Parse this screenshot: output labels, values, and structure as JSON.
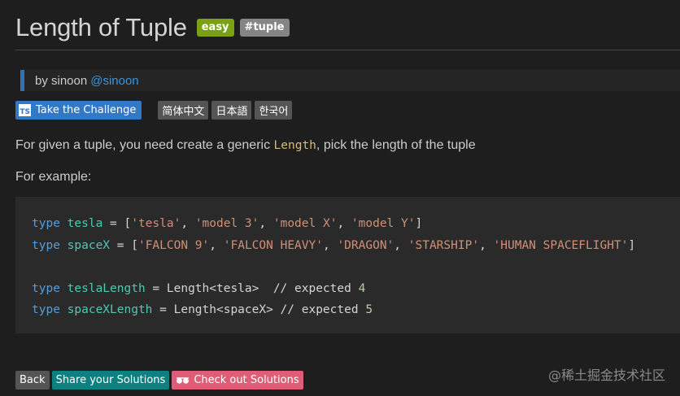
{
  "header": {
    "title": "Length of Tuple",
    "difficulty_badge": "easy",
    "tag_badge": "#tuple"
  },
  "author": {
    "prefix": "by sinoon",
    "handle": "@sinoon"
  },
  "actions": {
    "ts_icon_text": "TS",
    "take_challenge": "Take the Challenge",
    "languages": [
      "简体中文",
      "日本語",
      "한국어"
    ]
  },
  "description": {
    "before": "For given a tuple, you need create a generic ",
    "code": "Length",
    "after": ", pick the length of the tuple",
    "example_label": "For example:"
  },
  "code_lines": [
    "type tesla = ['tesla', 'model 3', 'model X', 'model Y']",
    "type spaceX = ['FALCON 9', 'FALCON HEAVY', 'DRAGON', 'STARSHIP', 'HUMAN SPACEFLIGHT']",
    "",
    "type teslaLength = Length<tesla>  // expected 4",
    "type spaceXLength = Length<spaceX> // expected 5"
  ],
  "bottom": {
    "back": "Back",
    "share": "Share your Solutions",
    "check": "Check out Solutions"
  },
  "watermark": "@稀土掘金技术社区",
  "colors": {
    "background": "#1e1e1e",
    "easy_badge": "#7aa116",
    "tag_badge": "#858585",
    "ts_button": "#3178c6",
    "share_button": "#0d8181",
    "check_button": "#e05d78",
    "link": "#3c94d8"
  },
  "icons": {
    "ts": "typescript-logo-icon",
    "check": "glasses-icon"
  }
}
